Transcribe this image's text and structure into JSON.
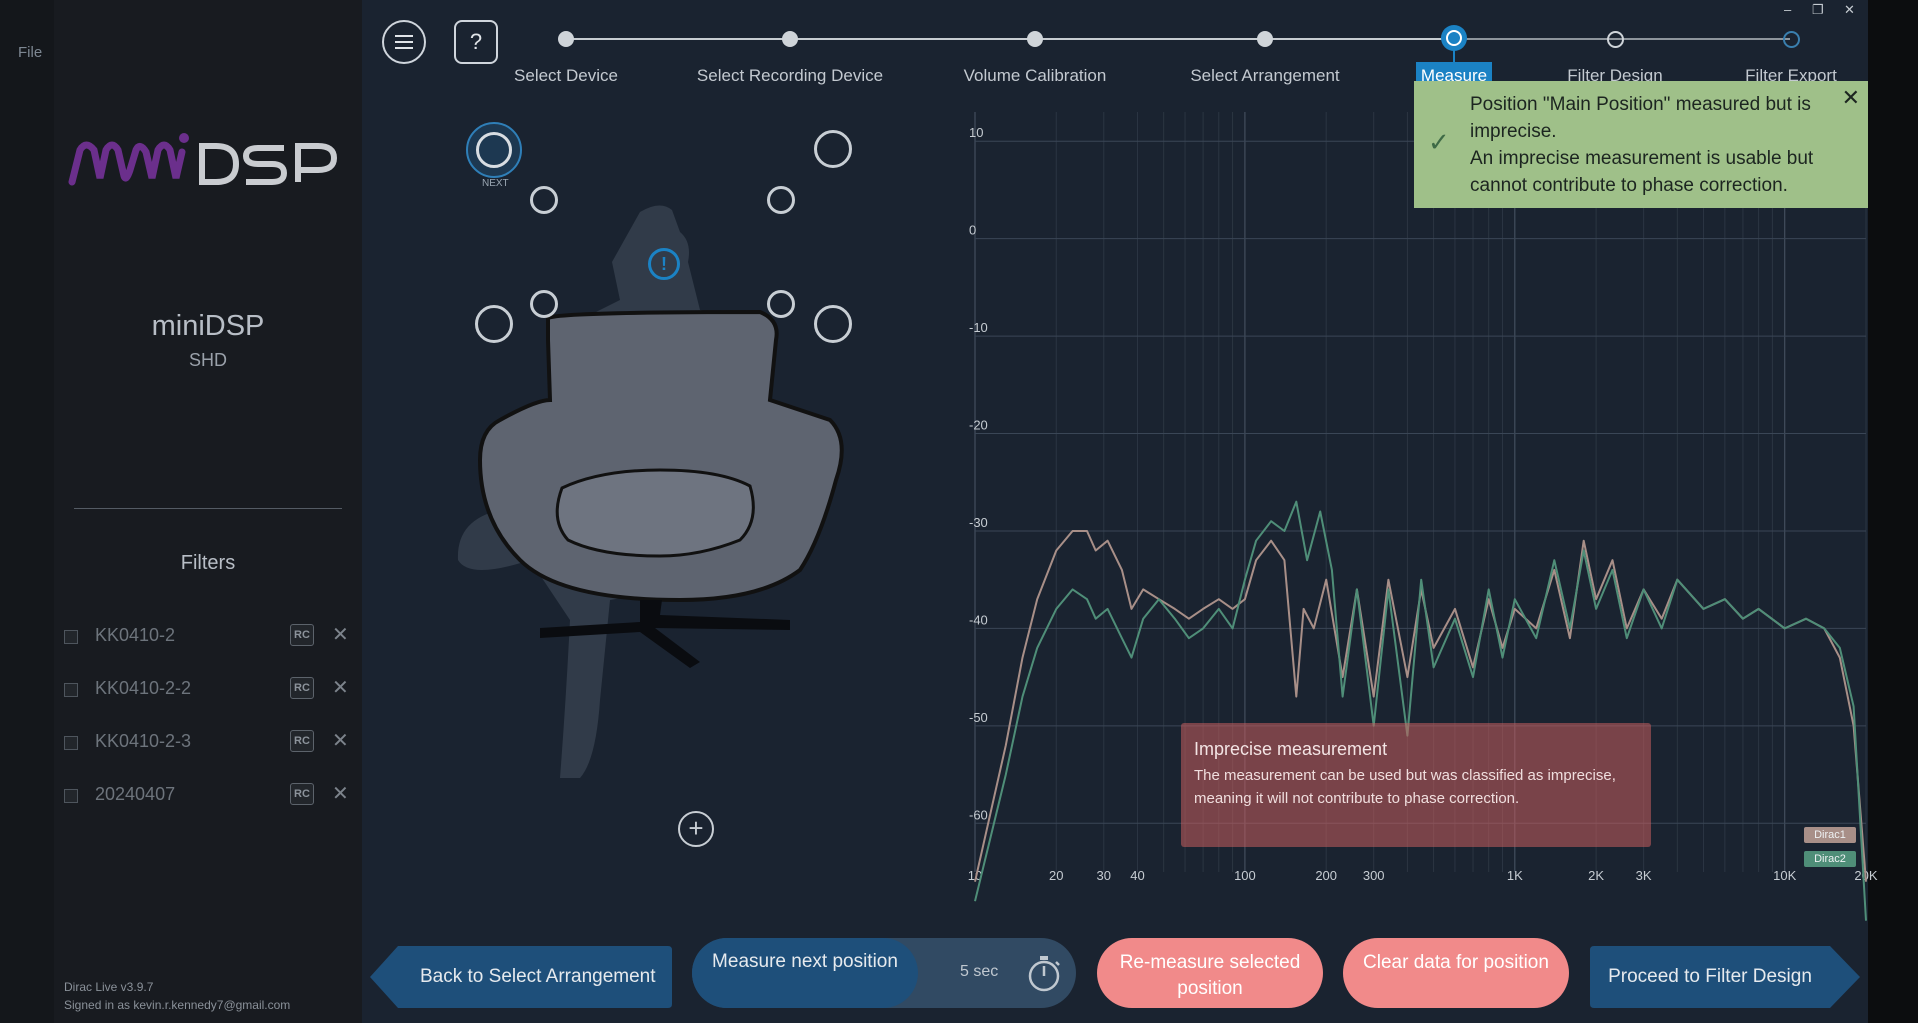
{
  "background": {
    "file_menu": "File"
  },
  "sidebar": {
    "logo_text": "miniDSP",
    "device_name": "miniDSP",
    "device_model": "SHD",
    "filters_title": "Filters",
    "filters": [
      {
        "label": "KK0410-2",
        "badge": "RC"
      },
      {
        "label": "KK0410-2-2",
        "badge": "RC"
      },
      {
        "label": "KK0410-2-3",
        "badge": "RC"
      },
      {
        "label": "20240407",
        "badge": "RC"
      }
    ],
    "remove_glyph": "✕",
    "version": "Dirac Live v3.9.7",
    "signed_in": "Signed in as kevin.r.kennedy7@gmail.com"
  },
  "header": {
    "menu_icon": "menu-icon",
    "help_label": "?",
    "steps": [
      {
        "label": "Select Device",
        "state": "done"
      },
      {
        "label": "Select Recording Device",
        "state": "done"
      },
      {
        "label": "Volume Calibration",
        "state": "done"
      },
      {
        "label": "Select Arrangement",
        "state": "done"
      },
      {
        "label": "Measure",
        "state": "active"
      },
      {
        "label": "Filter Design",
        "state": "todo"
      },
      {
        "label": "Filter Export",
        "state": "todo"
      }
    ],
    "window_controls": [
      "–",
      "❐",
      "✕"
    ]
  },
  "toast": {
    "line1": "Position \"Main Position\" measured but is imprecise.",
    "line2": "An imprecise measurement is usable but cannot contribute to phase correction.",
    "close": "✕",
    "check": "✓"
  },
  "seating": {
    "next_label": "NEXT",
    "active_glyph": "!",
    "add_glyph": "+"
  },
  "chart_data": {
    "type": "line",
    "x_scale": "log",
    "xlim": [
      10,
      20000
    ],
    "ylim": [
      -65,
      13
    ],
    "y_ticks": [
      10,
      0,
      -10,
      -20,
      -30,
      -40,
      -50,
      -60
    ],
    "x_ticks": [
      "10",
      "20",
      "30",
      "40",
      "100",
      "200",
      "300",
      "1K",
      "2K",
      "3K",
      "10K",
      "20K"
    ],
    "x_tick_values": [
      10,
      20,
      30,
      40,
      100,
      200,
      300,
      1000,
      2000,
      3000,
      10000,
      20000
    ],
    "grid": true,
    "legend_placement": "bottom-right",
    "series": [
      {
        "name": "Dirac1",
        "color": "#a88f88",
        "points": [
          [
            10,
            -66
          ],
          [
            13,
            -52
          ],
          [
            15,
            -43
          ],
          [
            17,
            -37
          ],
          [
            20,
            -32
          ],
          [
            23,
            -30
          ],
          [
            26,
            -30
          ],
          [
            28,
            -32
          ],
          [
            31,
            -31
          ],
          [
            35,
            -34
          ],
          [
            38,
            -38
          ],
          [
            42,
            -36
          ],
          [
            48,
            -37
          ],
          [
            55,
            -38
          ],
          [
            62,
            -39
          ],
          [
            70,
            -38
          ],
          [
            80,
            -37
          ],
          [
            90,
            -38
          ],
          [
            100,
            -37
          ],
          [
            110,
            -33
          ],
          [
            125,
            -31
          ],
          [
            140,
            -33
          ],
          [
            155,
            -47
          ],
          [
            165,
            -38
          ],
          [
            180,
            -40
          ],
          [
            200,
            -35
          ],
          [
            230,
            -45
          ],
          [
            260,
            -36
          ],
          [
            300,
            -47
          ],
          [
            340,
            -35
          ],
          [
            400,
            -45
          ],
          [
            450,
            -36
          ],
          [
            500,
            -42
          ],
          [
            600,
            -38
          ],
          [
            700,
            -44
          ],
          [
            800,
            -37
          ],
          [
            900,
            -42
          ],
          [
            1000,
            -38
          ],
          [
            1200,
            -40
          ],
          [
            1400,
            -34
          ],
          [
            1600,
            -41
          ],
          [
            1800,
            -31
          ],
          [
            2000,
            -37
          ],
          [
            2300,
            -33
          ],
          [
            2600,
            -40
          ],
          [
            3000,
            -36
          ],
          [
            3500,
            -39
          ],
          [
            4000,
            -35
          ],
          [
            5000,
            -38
          ],
          [
            6000,
            -37
          ],
          [
            7000,
            -39
          ],
          [
            8000,
            -38
          ],
          [
            10000,
            -40
          ],
          [
            12000,
            -39
          ],
          [
            14000,
            -40
          ],
          [
            16000,
            -43
          ],
          [
            18000,
            -50
          ],
          [
            20000,
            -66
          ]
        ]
      },
      {
        "name": "Dirac2",
        "color": "#4f8e78",
        "points": [
          [
            10,
            -68
          ],
          [
            13,
            -55
          ],
          [
            15,
            -47
          ],
          [
            17,
            -42
          ],
          [
            20,
            -38
          ],
          [
            23,
            -36
          ],
          [
            26,
            -37
          ],
          [
            28,
            -39
          ],
          [
            31,
            -38
          ],
          [
            35,
            -41
          ],
          [
            38,
            -43
          ],
          [
            42,
            -39
          ],
          [
            48,
            -37
          ],
          [
            55,
            -39
          ],
          [
            62,
            -41
          ],
          [
            70,
            -40
          ],
          [
            80,
            -38
          ],
          [
            90,
            -40
          ],
          [
            100,
            -35
          ],
          [
            110,
            -31
          ],
          [
            125,
            -29
          ],
          [
            140,
            -30
          ],
          [
            155,
            -27
          ],
          [
            170,
            -33
          ],
          [
            190,
            -28
          ],
          [
            210,
            -34
          ],
          [
            230,
            -47
          ],
          [
            260,
            -36
          ],
          [
            300,
            -50
          ],
          [
            340,
            -36
          ],
          [
            400,
            -51
          ],
          [
            450,
            -35
          ],
          [
            500,
            -44
          ],
          [
            600,
            -39
          ],
          [
            700,
            -45
          ],
          [
            800,
            -36
          ],
          [
            900,
            -43
          ],
          [
            1000,
            -37
          ],
          [
            1200,
            -41
          ],
          [
            1400,
            -33
          ],
          [
            1600,
            -40
          ],
          [
            1800,
            -32
          ],
          [
            2000,
            -38
          ],
          [
            2300,
            -34
          ],
          [
            2600,
            -41
          ],
          [
            3000,
            -36
          ],
          [
            3500,
            -40
          ],
          [
            4000,
            -35
          ],
          [
            5000,
            -38
          ],
          [
            6000,
            -37
          ],
          [
            7000,
            -39
          ],
          [
            8000,
            -38
          ],
          [
            10000,
            -40
          ],
          [
            12000,
            -39
          ],
          [
            14000,
            -40
          ],
          [
            16000,
            -42
          ],
          [
            18000,
            -48
          ],
          [
            20000,
            -70
          ]
        ]
      }
    ]
  },
  "warning": {
    "title": "Imprecise measurement",
    "body": "The measurement can be used but was classified as imprecise, meaning it will not contribute to phase correction."
  },
  "footer": {
    "back_label": "Back to Select Arrangement",
    "measure_label": "Measure next position",
    "measure_time": "5 sec",
    "remeasure_label": "Re-measure selected position",
    "clear_label": "Clear data for position",
    "proceed_label": "Proceed to Filter Design"
  },
  "colors": {
    "accent": "#1b82c4",
    "panel": "#1a2330",
    "sidebar": "#181b20",
    "toast": "#9fc089",
    "warning": "#c85f5f",
    "pink_button": "#f18a8a",
    "nav_button": "#1e4f7a"
  }
}
